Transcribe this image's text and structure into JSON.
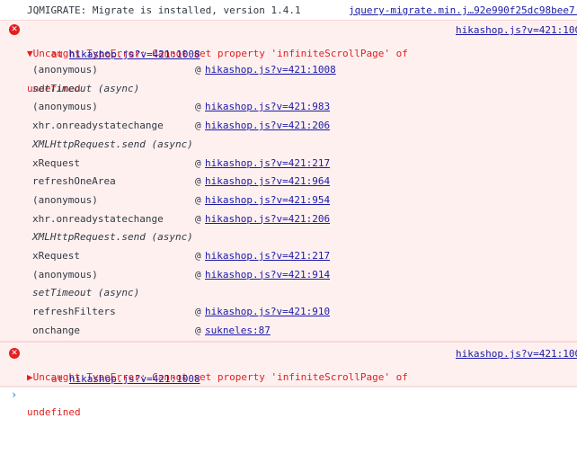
{
  "info": {
    "message": "JQMIGRATE: Migrate is installed, version 1.4.1",
    "source": "jquery-migrate.min.j…92e990f25dc98bee7:"
  },
  "error1": {
    "icon": "error-icon",
    "message_line1": "▼Uncaught TypeError: Cannot set property 'infiniteScrollPage' of",
    "message_line2": "undefined",
    "at_label": "at",
    "at_link": "hikashop.js?v=421:1008",
    "source": "hikashop.js?v=421:100",
    "stack": [
      {
        "type": "frame",
        "fn": "(anonymous)",
        "at": "@",
        "loc": "hikashop.js?v=421:1008"
      },
      {
        "type": "async",
        "label": "setTimeout (async)"
      },
      {
        "type": "frame",
        "fn": "(anonymous)",
        "at": "@",
        "loc": "hikashop.js?v=421:983"
      },
      {
        "type": "frame",
        "fn": "xhr.onreadystatechange",
        "at": "@",
        "loc": "hikashop.js?v=421:206"
      },
      {
        "type": "async",
        "label": "XMLHttpRequest.send (async)"
      },
      {
        "type": "frame",
        "fn": "xRequest",
        "at": "@",
        "loc": "hikashop.js?v=421:217"
      },
      {
        "type": "frame",
        "fn": "refreshOneArea",
        "at": "@",
        "loc": "hikashop.js?v=421:964"
      },
      {
        "type": "frame",
        "fn": "(anonymous)",
        "at": "@",
        "loc": "hikashop.js?v=421:954"
      },
      {
        "type": "frame",
        "fn": "xhr.onreadystatechange",
        "at": "@",
        "loc": "hikashop.js?v=421:206"
      },
      {
        "type": "async",
        "label": "XMLHttpRequest.send (async)"
      },
      {
        "type": "frame",
        "fn": "xRequest",
        "at": "@",
        "loc": "hikashop.js?v=421:217"
      },
      {
        "type": "frame",
        "fn": "(anonymous)",
        "at": "@",
        "loc": "hikashop.js?v=421:914"
      },
      {
        "type": "async",
        "label": "setTimeout (async)"
      },
      {
        "type": "frame",
        "fn": "refreshFilters",
        "at": "@",
        "loc": "hikashop.js?v=421:910"
      },
      {
        "type": "frame",
        "fn": "onchange",
        "at": "@",
        "loc": "sukneles:87"
      }
    ]
  },
  "error2": {
    "icon": "error-icon",
    "message_line1": "▶Uncaught TypeError: Cannot set property 'infiniteScrollPage' of",
    "message_line2": "undefined",
    "at_label": "at",
    "at_link": "hikashop.js?v=421:1008",
    "source": "hikashop.js?v=421:100"
  },
  "prompt": {
    "symbol": "›"
  },
  "colors": {
    "error_red": "#e02020",
    "error_bg": "#fff0f0",
    "link": "#1a1aa6",
    "prompt": "#2a7fd4"
  }
}
